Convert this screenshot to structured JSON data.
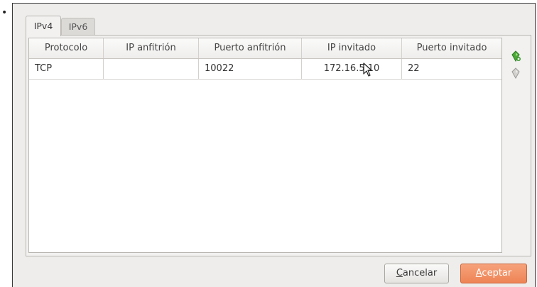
{
  "tabs": [
    {
      "label": "IPv4",
      "active": true
    },
    {
      "label": "IPv6",
      "active": false
    }
  ],
  "table": {
    "columns": [
      "Protocolo",
      "IP anfitrión",
      "Puerto anfitrión",
      "IP invitado",
      "Puerto invitado"
    ],
    "rows": [
      [
        "TCP",
        "",
        "10022",
        "172.16.5.10",
        "22"
      ]
    ]
  },
  "side_actions": [
    {
      "icon": "add-rule-icon",
      "color": "#3c9a2e"
    },
    {
      "icon": "remove-rule-icon",
      "color": "#9c9a97"
    }
  ],
  "buttons": {
    "cancel": {
      "mnemonic": "C",
      "rest": "ancelar"
    },
    "accept": {
      "mnemonic": "A",
      "rest": "ceptar",
      "color": "#ee8455"
    }
  },
  "bullet": "•"
}
